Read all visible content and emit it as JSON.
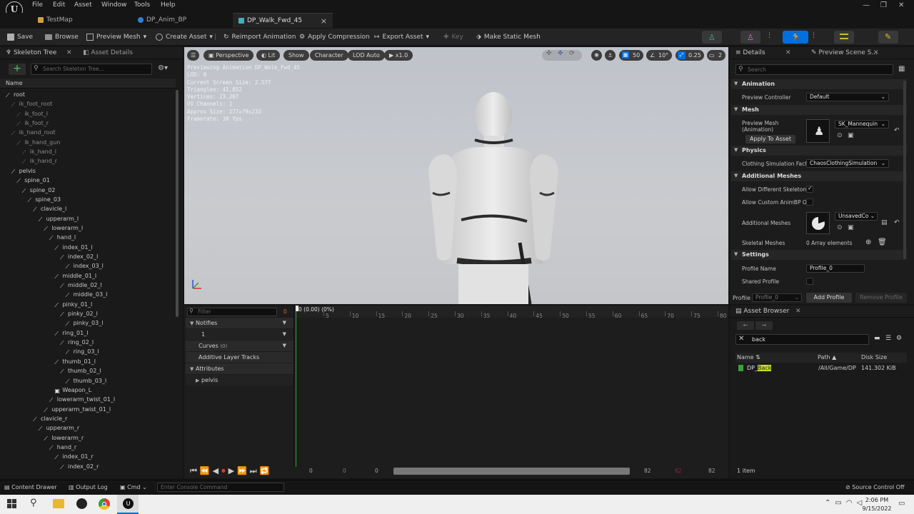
{
  "app": {
    "logo": "U",
    "menus": [
      "File",
      "Edit",
      "Asset",
      "Window",
      "Tools",
      "Help"
    ],
    "window_controls": [
      "—",
      "❐",
      "✕"
    ]
  },
  "tabs": [
    {
      "label": "TestMap",
      "active": false
    },
    {
      "label": "DP_Anim_BP",
      "active": false
    },
    {
      "label": "DP_Walk_Fwd_45",
      "active": true,
      "close": "×"
    }
  ],
  "toolbar": {
    "save": "Save",
    "browse": "Browse",
    "preview_mesh": "Preview Mesh",
    "create_asset": "Create Asset",
    "reimport": "Reimport Animation",
    "apply_compression": "Apply Compression",
    "export_asset": "Export Asset",
    "key": "Key",
    "make_static": "Make Static Mesh"
  },
  "skeleton": {
    "tab1": "Skeleton Tree",
    "tab2": "Asset Details",
    "search_placeholder": "Search Skeleton Tree...",
    "col_name": "Name",
    "bones": [
      {
        "n": "root",
        "d": 1,
        "dim": false,
        "sock": false
      },
      {
        "n": "ik_foot_root",
        "d": 2,
        "dim": true,
        "sock": false
      },
      {
        "n": "ik_foot_l",
        "d": 3,
        "dim": true,
        "sock": false
      },
      {
        "n": "ik_foot_r",
        "d": 3,
        "dim": true,
        "sock": false
      },
      {
        "n": "ik_hand_root",
        "d": 2,
        "dim": true,
        "sock": false
      },
      {
        "n": "ik_hand_gun",
        "d": 3,
        "dim": true,
        "sock": false
      },
      {
        "n": "ik_hand_l",
        "d": 4,
        "dim": true,
        "sock": false
      },
      {
        "n": "ik_hand_r",
        "d": 4,
        "dim": true,
        "sock": false
      },
      {
        "n": "pelvis",
        "d": 2,
        "dim": false,
        "sock": false
      },
      {
        "n": "spine_01",
        "d": 3,
        "dim": false,
        "sock": false
      },
      {
        "n": "spine_02",
        "d": 4,
        "dim": false,
        "sock": false
      },
      {
        "n": "spine_03",
        "d": 5,
        "dim": false,
        "sock": false
      },
      {
        "n": "clavicle_l",
        "d": 6,
        "dim": false,
        "sock": false
      },
      {
        "n": "upperarm_l",
        "d": 7,
        "dim": false,
        "sock": false
      },
      {
        "n": "lowerarm_l",
        "d": 8,
        "dim": false,
        "sock": false
      },
      {
        "n": "hand_l",
        "d": 9,
        "dim": false,
        "sock": false
      },
      {
        "n": "index_01_l",
        "d": 10,
        "dim": false,
        "sock": false
      },
      {
        "n": "index_02_l",
        "d": 11,
        "dim": false,
        "sock": false
      },
      {
        "n": "index_03_l",
        "d": 12,
        "dim": false,
        "sock": false
      },
      {
        "n": "middle_01_l",
        "d": 10,
        "dim": false,
        "sock": false
      },
      {
        "n": "middle_02_l",
        "d": 11,
        "dim": false,
        "sock": false
      },
      {
        "n": "middle_03_l",
        "d": 12,
        "dim": false,
        "sock": false
      },
      {
        "n": "pinky_01_l",
        "d": 10,
        "dim": false,
        "sock": false
      },
      {
        "n": "pinky_02_l",
        "d": 11,
        "dim": false,
        "sock": false
      },
      {
        "n": "pinky_03_l",
        "d": 12,
        "dim": false,
        "sock": false
      },
      {
        "n": "ring_01_l",
        "d": 10,
        "dim": false,
        "sock": false
      },
      {
        "n": "ring_02_l",
        "d": 11,
        "dim": false,
        "sock": false
      },
      {
        "n": "ring_03_l",
        "d": 12,
        "dim": false,
        "sock": false
      },
      {
        "n": "thumb_01_l",
        "d": 10,
        "dim": false,
        "sock": false
      },
      {
        "n": "thumb_02_l",
        "d": 11,
        "dim": false,
        "sock": false
      },
      {
        "n": "thumb_03_l",
        "d": 12,
        "dim": false,
        "sock": false
      },
      {
        "n": "Weapon_L",
        "d": 10,
        "dim": false,
        "sock": true
      },
      {
        "n": "lowerarm_twist_01_l",
        "d": 9,
        "dim": false,
        "sock": false
      },
      {
        "n": "upperarm_twist_01_l",
        "d": 8,
        "dim": false,
        "sock": false
      },
      {
        "n": "clavicle_r",
        "d": 6,
        "dim": false,
        "sock": false
      },
      {
        "n": "upperarm_r",
        "d": 7,
        "dim": false,
        "sock": false
      },
      {
        "n": "lowerarm_r",
        "d": 8,
        "dim": false,
        "sock": false
      },
      {
        "n": "hand_r",
        "d": 9,
        "dim": false,
        "sock": false
      },
      {
        "n": "index_01_r",
        "d": 10,
        "dim": false,
        "sock": false
      },
      {
        "n": "index_02_r",
        "d": 11,
        "dim": false,
        "sock": false
      }
    ]
  },
  "viewport": {
    "perspective": "Perspective",
    "lit": "Lit",
    "show": "Show",
    "character": "Character",
    "lod": "LOD Auto",
    "speed": "x1.0",
    "stats": [
      "Previewing Animation DP_Walk_Fwd_45",
      "LOD: 0",
      "Current Screen Size: 2.577",
      "Triangles: 41,052",
      "Vertices: 23,207",
      "UV Channels: 1",
      "Approx Size: 277x79x233",
      "Framerate: 30 fps"
    ],
    "grid": "50",
    "angle": "10°",
    "scale": "0.25",
    "cams": "2"
  },
  "details": {
    "tab": "Details",
    "tab2": "Preview Scene S...",
    "search_placeholder": "Search",
    "animation": "Animation",
    "preview_controller_label": "Preview Controller",
    "preview_controller": "Default",
    "mesh": "Mesh",
    "preview_mesh_label": "Preview Mesh",
    "preview_mesh_sub": "(Animation)",
    "preview_mesh_value": "SK_Mannequin",
    "apply_to_asset": "Apply To Asset",
    "physics": "Physics",
    "clothing_label": "Clothing Simulation Fact",
    "clothing_value": "ChaosClothingSimulation",
    "additional": "Additional Meshes",
    "allow_diff_label": "Allow Different Skeleton",
    "allow_custom_label": "Allow Custom AnimBP O",
    "additional_meshes_label": "Additional Meshes",
    "additional_meshes_value": "UnsavedCo",
    "skeletal_meshes_label": "Skeletal Meshes",
    "skeletal_meshes_value": "0 Array elements",
    "settings": "Settings",
    "profile_name_label": "Profile Name",
    "profile_name_value": "Profile_0",
    "shared_profile_label": "Shared Profile",
    "profile_label": "Profile",
    "profile_value": "Profile_0",
    "add_profile": "Add Profile",
    "remove_profile": "Remove Profile"
  },
  "timeline": {
    "filter_placeholder": "Filter",
    "filter_count": "0",
    "notifies": "Notifies",
    "track1": "1",
    "curves": "Curves",
    "curves_count": "(0)",
    "additive": "Additive Layer Tracks",
    "attributes": "Attributes",
    "pelvis": "pelvis",
    "current": "0 (0.00) (0%)",
    "ticks": [
      "5",
      "10",
      "15",
      "20",
      "25",
      "30",
      "35",
      "40",
      "45",
      "50",
      "55",
      "60",
      "65",
      "70",
      "75",
      "80"
    ],
    "start": "0",
    "start2": "0",
    "start3": "0",
    "end1": "82",
    "end2": "82"
  },
  "asset_browser": {
    "tab": "Asset Browser",
    "search": "back",
    "col_name": "Name",
    "col_path": "Path",
    "col_size": "Disk Size",
    "row_prefix": "DP_",
    "row_hl": "Back",
    "row_path": "/All/Game/DP",
    "row_size": "141.302 KiB",
    "count": "1 item"
  },
  "bottombar": {
    "content_drawer": "Content Drawer",
    "output_log": "Output Log",
    "cmd": "Cmd",
    "console_placeholder": "Enter Console Command",
    "source_control": "Source Control Off"
  },
  "taskbar": {
    "time": "2:06 PM",
    "date": "9/15/2022"
  },
  "colors": {
    "accent": "#0070e0",
    "select": "#5aa0ff",
    "bg": "#1a1a1a",
    "highlight": "#c8e020"
  }
}
